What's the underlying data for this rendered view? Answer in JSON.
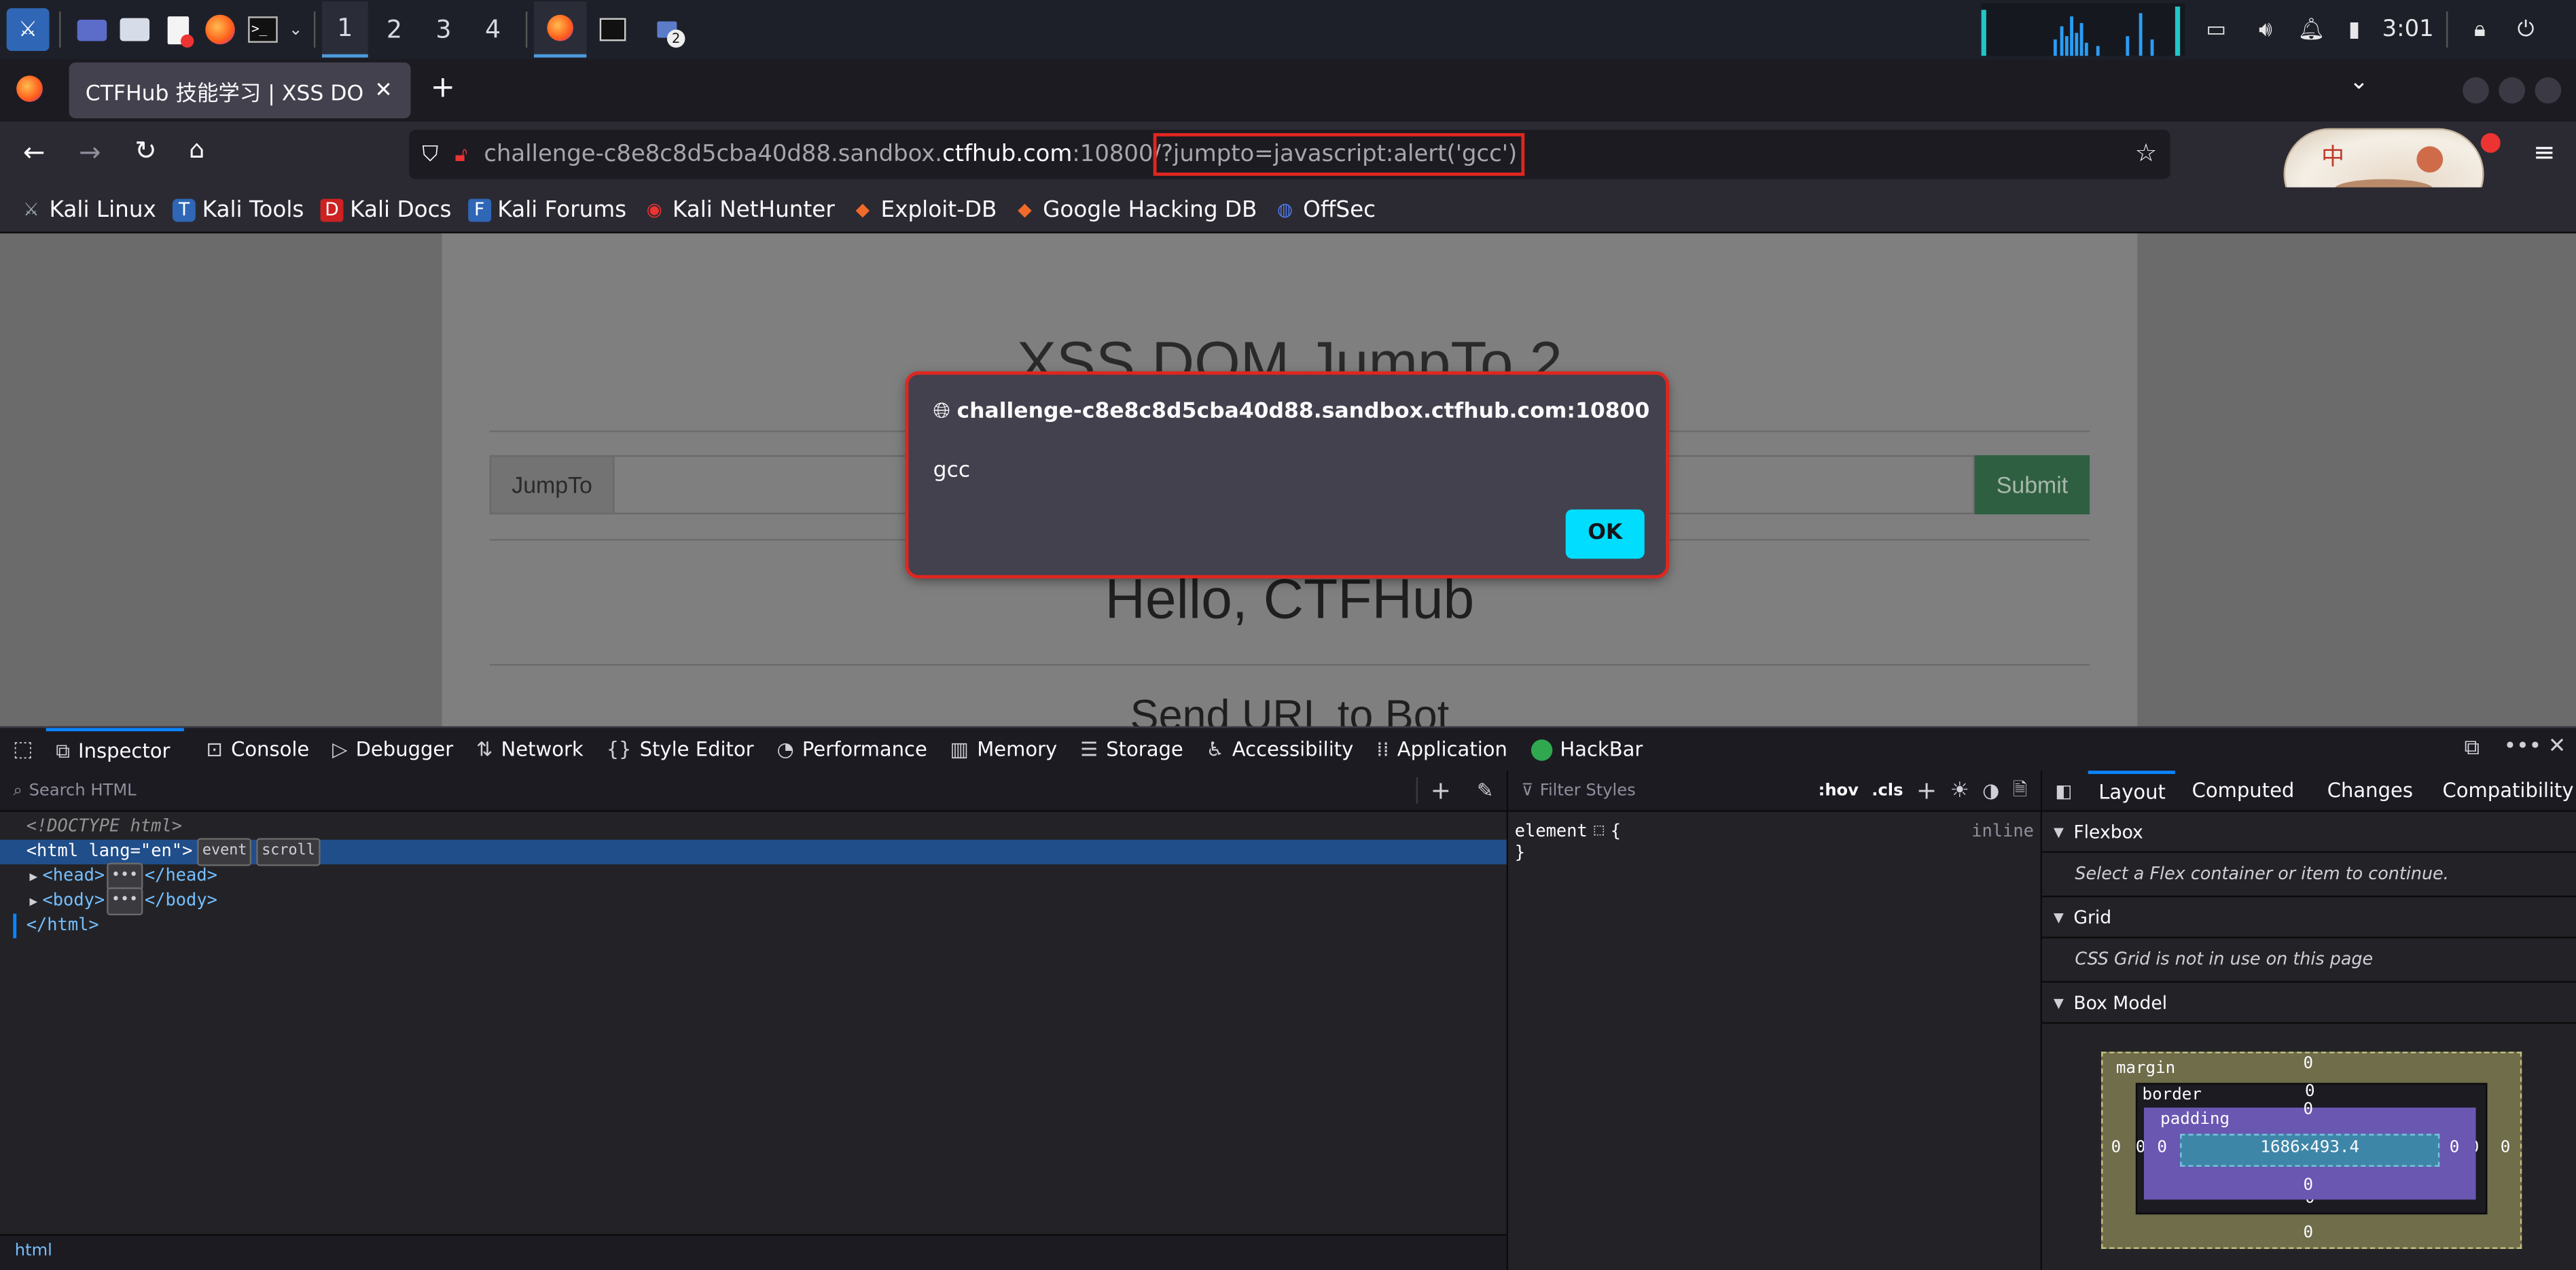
{
  "taskbar": {
    "workspaces": [
      "1",
      "2",
      "3",
      "4"
    ],
    "notification_count": "2",
    "clock": "3:01"
  },
  "browser": {
    "tab_title": "CTFHub 技能学习 | XSS DOM",
    "url_prefix": "challenge-c8e8c8d5cba40d88.sandbox.",
    "url_domain": "ctfhub.com",
    "url_port": ":10800/",
    "url_query": "?jumpto=javascript:alert('gcc')",
    "bookmarks": [
      "Kali Linux",
      "Kali Tools",
      "Kali Docs",
      "Kali Forums",
      "Kali NetHunter",
      "Exploit-DB",
      "Google Hacking DB",
      "OffSec"
    ],
    "profile_badge_text": "中"
  },
  "page": {
    "heading": "XSS DOM JumpTo 2",
    "input_addon": "JumpTo",
    "submit_label": "Submit",
    "hello": "Hello, CTFHub",
    "send_title": "Send URL to Bot"
  },
  "dialog": {
    "origin": "challenge-c8e8c8d5cba40d88.sandbox.ctfhub.com:10800",
    "message": "gcc",
    "ok_label": "OK"
  },
  "devtools": {
    "tabs": [
      "Inspector",
      "Console",
      "Debugger",
      "Network",
      "Style Editor",
      "Performance",
      "Memory",
      "Storage",
      "Accessibility",
      "Application",
      "HackBar"
    ],
    "search_placeholder": "Search HTML",
    "filter_placeholder": "Filter Styles",
    "hov": ":hov",
    "cls": ".cls",
    "html_lines": {
      "doctype": "<!DOCTYPE html>",
      "html_open_tag": "<html",
      "html_attr": "lang",
      "html_attr_val": "\"en\"",
      "html_close_bracket": ">",
      "badge_event": "event",
      "badge_scroll": "scroll",
      "head": "<head>",
      "head_close": "</head>",
      "body": "<body>",
      "body_close": "</body>",
      "html_close": "</html>"
    },
    "rule_selector": "element",
    "rule_open": "{",
    "rule_close": "}",
    "rule_source": "inline",
    "layout_tabs": [
      "Layout",
      "Computed",
      "Changes",
      "Compatibility"
    ],
    "flexbox_title": "Flexbox",
    "flexbox_msg": "Select a Flex container or item to continue.",
    "grid_title": "Grid",
    "grid_msg": "CSS Grid is not in use on this page",
    "boxmodel_title": "Box Model",
    "box": {
      "margin_label": "margin",
      "border_label": "border",
      "padding_label": "padding",
      "content_size": "1686×493.4",
      "zero": "0"
    },
    "breadcrumb": "html"
  }
}
